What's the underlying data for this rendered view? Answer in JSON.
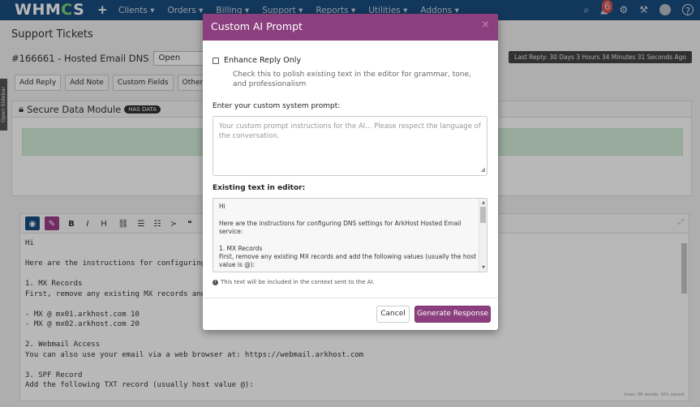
{
  "topnav": {
    "logo_left": "WHM",
    "logo_gear": "C",
    "logo_right": "S",
    "plus": "+",
    "menu": [
      "Clients ▾",
      "Orders ▾",
      "Billing ▾",
      "Support ▾",
      "Reports ▾",
      "Utilities ▾",
      "Addons ▾"
    ],
    "notification_count": "6"
  },
  "page": {
    "title": "Support Tickets",
    "ticket_id": "#166661 - Hosted Email DNS",
    "status_value": "Open",
    "last_reply": "Last Reply: 30 Days 3 Hours 34 Minutes 31 Seconds Ago",
    "tabs": [
      "Add Reply",
      "Add Note",
      "Custom Fields",
      "Other Tickets"
    ],
    "sidebar_tab": "Open Sidebar",
    "secure_title": "Secure Data Module",
    "secure_badge": "HAS DATA"
  },
  "editor": {
    "toolbar_text_buttons": [
      "B",
      "I",
      "H"
    ],
    "lines": [
      "Hi",
      "",
      "Here are the instructions for configuring D",
      "",
      "1. MX Records",
      "First, remove any existing MX records and a",
      "",
      "- MX @ mx01.arkhost.com 10",
      "- MX @ mx02.arkhost.com 20",
      "",
      "2. Webmail Access",
      "You can also use your email via a web browser at: https://webmail.arkhost.com",
      "",
      "3. SPF Record",
      "Add the following TXT record (usually host value @):"
    ],
    "status": "lines: 36   words: 101   saved"
  },
  "modal": {
    "title": "Custom AI Prompt",
    "close": "×",
    "enhance_label": "Enhance Reply Only",
    "enhance_help": "Check this to polish existing text in the editor for grammar, tone, and professionalism",
    "prompt_label": "Enter your custom system prompt:",
    "prompt_placeholder": "Your custom prompt instructions for the AI... Please respect the language of the conversation.",
    "existing_label": "Existing text in editor:",
    "existing_lines": [
      "Hi",
      "",
      "Here are the instructions for configuring DNS settings for ArkHost Hosted Email service:",
      "",
      "1. MX Records",
      "First, remove any existing MX records and add the following values (usually the host value is @):"
    ],
    "info_note": "This text will be included in the context sent to the AI.",
    "cancel_label": "Cancel",
    "generate_label": "Generate Response"
  }
}
